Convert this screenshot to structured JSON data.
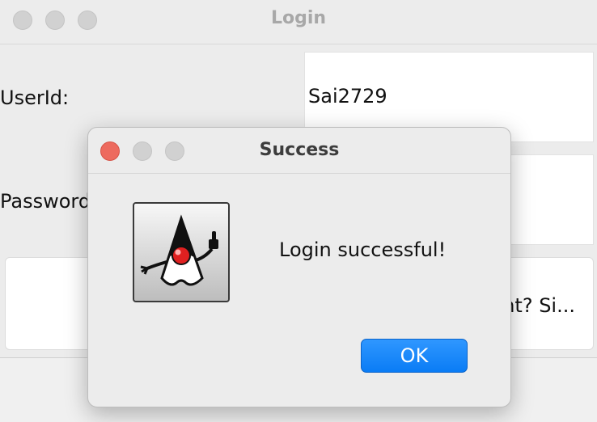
{
  "login_window": {
    "title": "Login",
    "userid_label": "UserId:",
    "userid_value": "Sai2729",
    "password_label": "Password",
    "signup_text": "unt? Si..."
  },
  "dialog": {
    "title": "Success",
    "message": "Login successful!",
    "ok_label": "OK",
    "icon": "duke-icon"
  },
  "colors": {
    "close_red": "#ed6a5e",
    "ok_blue": "#1a88ff"
  }
}
